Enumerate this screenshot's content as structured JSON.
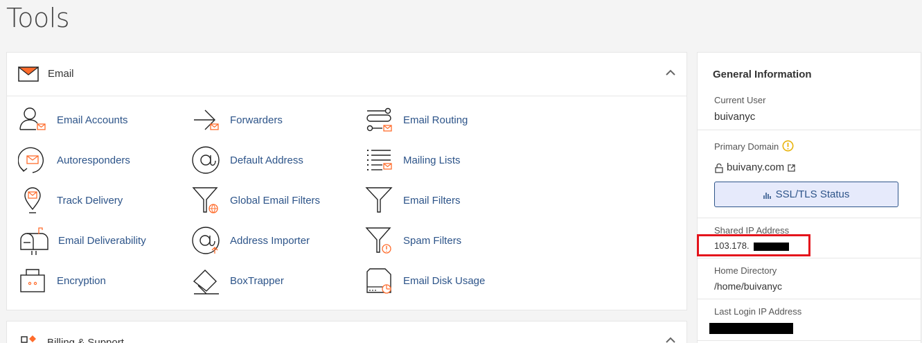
{
  "page": {
    "title": "Tools"
  },
  "email_panel": {
    "title": "Email",
    "tools": [
      {
        "label": "Email Accounts",
        "icon": "email-accounts-icon"
      },
      {
        "label": "Forwarders",
        "icon": "forwarders-icon"
      },
      {
        "label": "Email Routing",
        "icon": "email-routing-icon"
      },
      {
        "label": "Autoresponders",
        "icon": "autoresponders-icon"
      },
      {
        "label": "Default Address",
        "icon": "default-address-icon"
      },
      {
        "label": "Mailing Lists",
        "icon": "mailing-lists-icon"
      },
      {
        "label": "Track Delivery",
        "icon": "track-delivery-icon"
      },
      {
        "label": "Global Email Filters",
        "icon": "global-email-filters-icon"
      },
      {
        "label": "Email Filters",
        "icon": "email-filters-icon"
      },
      {
        "label": "Email Deliverability",
        "icon": "email-deliverability-icon"
      },
      {
        "label": "Address Importer",
        "icon": "address-importer-icon"
      },
      {
        "label": "Spam Filters",
        "icon": "spam-filters-icon"
      },
      {
        "label": "Encryption",
        "icon": "encryption-icon"
      },
      {
        "label": "BoxTrapper",
        "icon": "boxtrapper-icon"
      },
      {
        "label": "Email Disk Usage",
        "icon": "email-disk-usage-icon"
      }
    ]
  },
  "billing_panel": {
    "title": "Billing & Support"
  },
  "general_info": {
    "title": "General Information",
    "current_user_label": "Current User",
    "current_user": "buivanyc",
    "primary_domain_label": "Primary Domain",
    "primary_domain": "buivany.com",
    "ssl_button": "SSL/TLS Status",
    "shared_ip_label": "Shared IP Address",
    "shared_ip_prefix": "103.178.",
    "home_dir_label": "Home Directory",
    "home_dir": "/home/buivanyc",
    "last_login_label": "Last Login IP Address"
  },
  "colors": {
    "accent": "#2d5489",
    "orange": "#ff6c2c",
    "warning": "#e8b30b",
    "highlight": "#e4141c"
  }
}
